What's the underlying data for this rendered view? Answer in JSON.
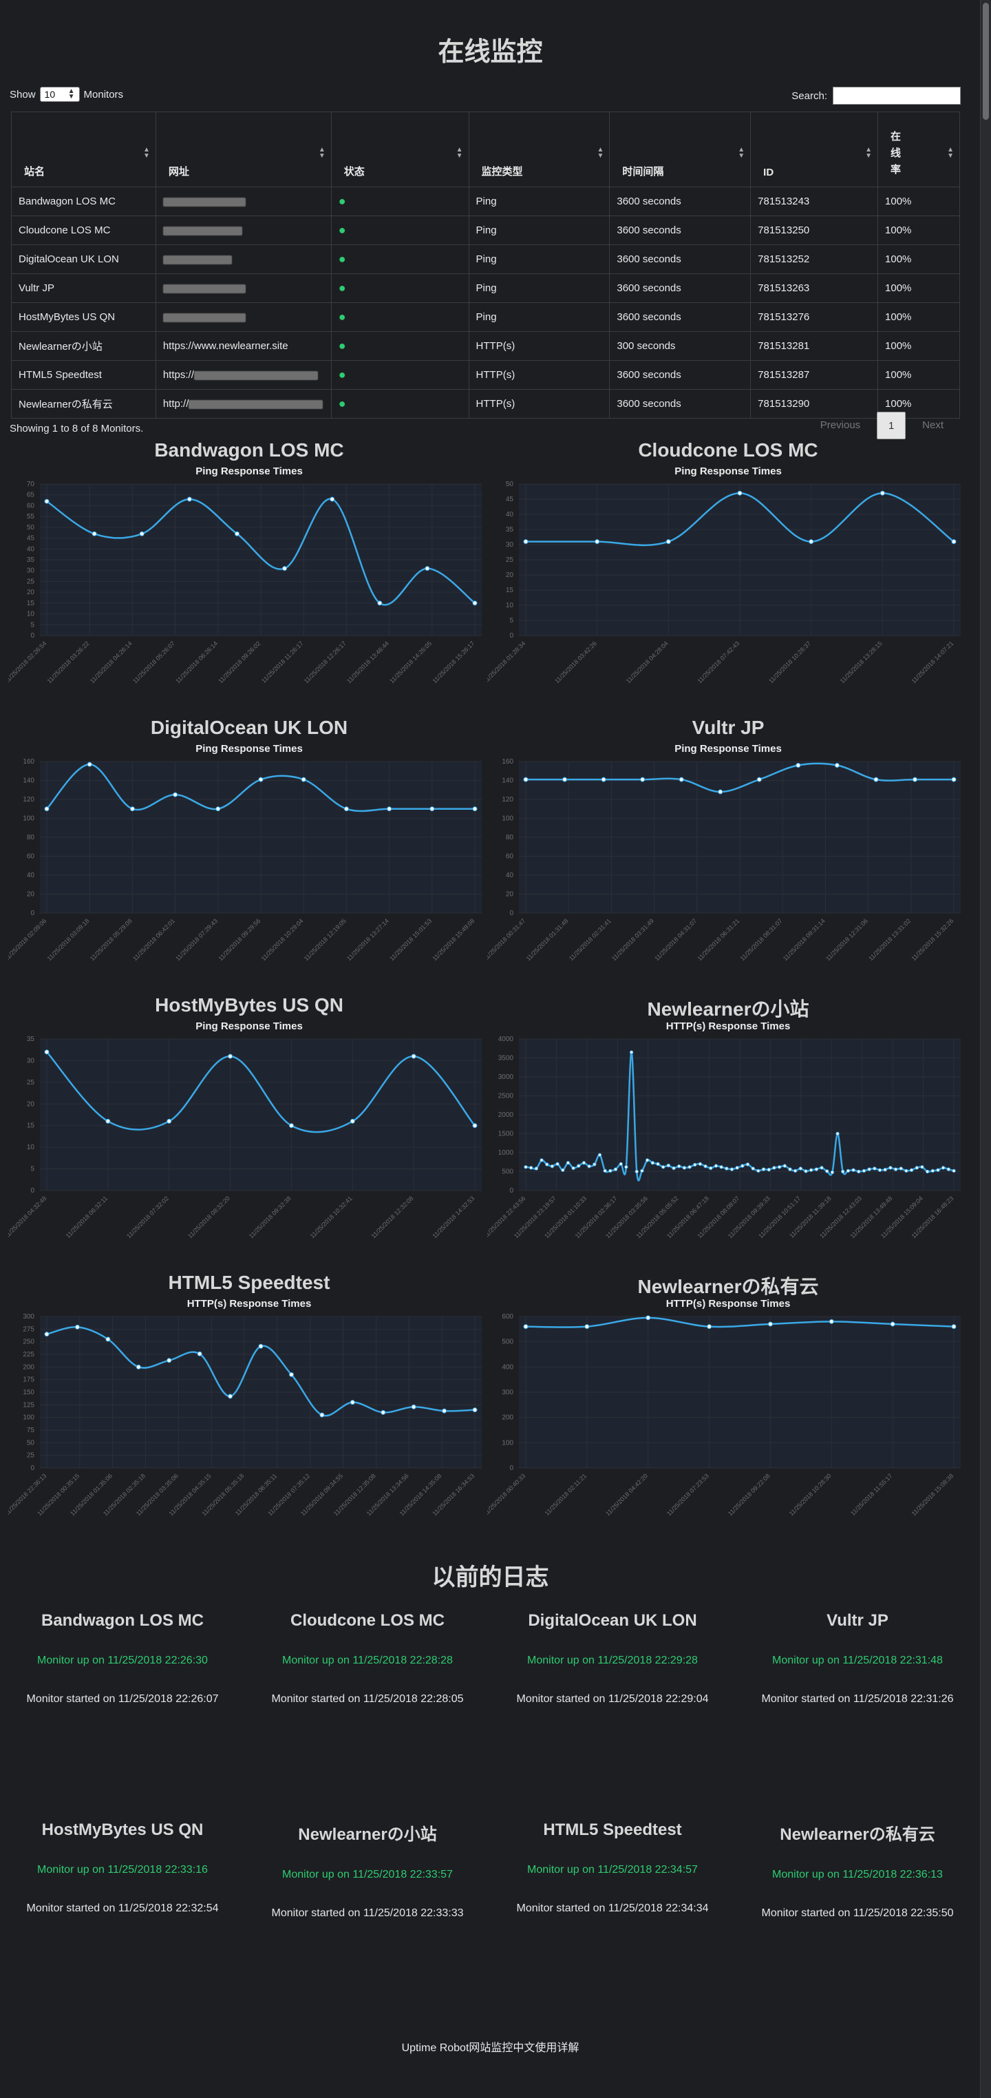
{
  "page": {
    "title": "在线监控"
  },
  "controls": {
    "show_label": "Show",
    "show_value": "10",
    "monitors_label": "Monitors",
    "search_label": "Search:"
  },
  "table": {
    "headers": [
      "站名",
      "网址",
      "状态",
      "监控类型",
      "时间间隔",
      "ID",
      "在线率"
    ],
    "rows": [
      {
        "name": "Bandwagon LOS MC",
        "url": "",
        "status": "●",
        "type": "Ping",
        "interval": "3600 seconds",
        "id": "781513243",
        "uptime": "100%"
      },
      {
        "name": "Cloudcone LOS MC",
        "url": "",
        "status": "●",
        "type": "Ping",
        "interval": "3600 seconds",
        "id": "781513250",
        "uptime": "100%"
      },
      {
        "name": "DigitalOcean UK LON",
        "url": "",
        "status": "●",
        "type": "Ping",
        "interval": "3600 seconds",
        "id": "781513252",
        "uptime": "100%"
      },
      {
        "name": "Vultr JP",
        "url": "",
        "status": "●",
        "type": "Ping",
        "interval": "3600 seconds",
        "id": "781513263",
        "uptime": "100%"
      },
      {
        "name": "HostMyBytes US QN",
        "url": "",
        "status": "●",
        "type": "Ping",
        "interval": "3600 seconds",
        "id": "781513276",
        "uptime": "100%"
      },
      {
        "name": "Newlearnerの小站",
        "url": "https://www.newlearner.site",
        "status": "●",
        "type": "HTTP(s)",
        "interval": "300 seconds",
        "id": "781513281",
        "uptime": "100%"
      },
      {
        "name": "HTML5 Speedtest",
        "url": "https://",
        "status": "●",
        "type": "HTTP(s)",
        "interval": "3600 seconds",
        "id": "781513287",
        "uptime": "100%"
      },
      {
        "name": "Newlearnerの私有云",
        "url": "http://",
        "status": "●",
        "type": "HTTP(s)",
        "interval": "3600 seconds",
        "id": "781513290",
        "uptime": "100%"
      }
    ],
    "info": "Showing 1 to 8 of 8 Monitors.",
    "pager": {
      "previous": "Previous",
      "current": "1",
      "next": "Next"
    }
  },
  "colors": {
    "line": "#3aa9e8",
    "status_up": "#2ecc71",
    "background": "#1d1e22"
  },
  "chart_data": [
    {
      "type": "line",
      "title": "Bandwagon LOS MC",
      "subtitle": "Ping Response Times",
      "ylim": [
        0,
        70
      ],
      "yticks": [
        0,
        5,
        10,
        15,
        20,
        25,
        30,
        35,
        40,
        45,
        50,
        55,
        60,
        65,
        70
      ],
      "x": [
        "11/25/2018 02:26:54",
        "11/25/2018 03:26:22",
        "11/25/2018 04:26:14",
        "11/25/2018 05:26:07",
        "11/25/2018 06:26:14",
        "11/25/2018 09:26:02",
        "11/25/2018 11:26:17",
        "11/25/2018 12:26:17",
        "11/25/2018 13:46:44",
        "11/25/2018 14:26:05",
        "11/25/2018 15:26:17"
      ],
      "values": [
        62,
        47,
        47,
        63,
        47,
        31,
        63,
        15,
        31,
        15
      ]
    },
    {
      "type": "line",
      "title": "Cloudcone LOS MC",
      "subtitle": "Ping Response Times",
      "ylim": [
        0,
        50
      ],
      "yticks": [
        0,
        5,
        10,
        15,
        20,
        25,
        30,
        35,
        40,
        45,
        50
      ],
      "x": [
        "11/25/2018 01:28:34",
        "11/25/2018 03:42:26",
        "11/25/2018 04:28:04",
        "11/25/2018 07:42:43",
        "11/25/2018 10:28:37",
        "11/25/2018 13:28:15",
        "11/25/2018 14:07:21"
      ],
      "values": [
        31,
        31,
        31,
        47,
        31,
        47,
        31
      ]
    },
    {
      "type": "line",
      "title": "DigitalOcean UK LON",
      "subtitle": "Ping Response Times",
      "ylim": [
        0,
        160
      ],
      "yticks": [
        0,
        20,
        40,
        60,
        80,
        100,
        120,
        140,
        160
      ],
      "x": [
        "11/25/2018 02:09:06",
        "11/25/2018 03:09:18",
        "11/25/2018 05:29:08",
        "11/25/2018 06:42:01",
        "11/25/2018 07:29:43",
        "11/25/2018 09:29:56",
        "11/25/2018 10:29:04",
        "11/25/2018 12:19:05",
        "11/25/2018 13:27:14",
        "11/25/2018 15:01:53",
        "11/25/2018 15:49:08"
      ],
      "values": [
        110,
        157,
        110,
        125,
        110,
        141,
        141,
        110,
        110,
        110,
        110
      ]
    },
    {
      "type": "line",
      "title": "Vultr JP",
      "subtitle": "Ping Response Times",
      "ylim": [
        0,
        160
      ],
      "yticks": [
        0,
        20,
        40,
        60,
        80,
        100,
        120,
        140,
        160
      ],
      "x": [
        "11/25/2018 00:31:47",
        "11/25/2018 01:31:48",
        "11/25/2018 02:31:41",
        "11/25/2018 03:31:49",
        "11/25/2018 04:31:07",
        "11/25/2018 06:31:21",
        "11/25/2018 08:31:07",
        "11/25/2018 09:31:14",
        "11/25/2018 12:31:06",
        "11/25/2018 13:31:02",
        "11/25/2018 15:32:26"
      ],
      "values": [
        141,
        141,
        141,
        141,
        141,
        128,
        141,
        156,
        156,
        141,
        141,
        141
      ]
    },
    {
      "type": "line",
      "title": "HostMyBytes US QN",
      "subtitle": "Ping Response Times",
      "ylim": [
        0,
        35
      ],
      "yticks": [
        0,
        5,
        10,
        15,
        20,
        25,
        30,
        35
      ],
      "x": [
        "11/25/2018 04:32:48",
        "11/25/2018 06:32:11",
        "11/25/2018 07:32:02",
        "11/25/2018 08:32:20",
        "11/25/2018 09:32:38",
        "11/25/2018 10:32:41",
        "11/25/2018 12:32:08",
        "11/25/2018 14:32:53"
      ],
      "values": [
        32,
        16,
        16,
        31,
        15,
        16,
        31,
        15
      ]
    },
    {
      "type": "line",
      "title": "Newlearnerの小站",
      "subtitle": "HTTP(s) Response Times",
      "ylim": [
        0,
        4000
      ],
      "yticks": [
        0,
        500,
        1000,
        1500,
        2000,
        2500,
        3000,
        3500,
        4000
      ],
      "x": [
        "11/25/2018 22:43:56",
        "11/25/2018 23:19:57",
        "11/25/2018 01:10:33",
        "11/25/2018 02:36:17",
        "11/25/2018 03:35:56",
        "11/25/2018 05:05:52",
        "11/25/2018 06:47:18",
        "11/25/2018 08:08:07",
        "11/25/2018 09:39:33",
        "11/25/2018 10:51:17",
        "11/25/2018 11:39:18",
        "11/25/2018 12:43:03",
        "11/25/2018 13:49:48",
        "11/25/2018 15:09:04",
        "11/25/2018 16:48:23"
      ],
      "values": [
        620,
        600,
        580,
        800,
        690,
        640,
        700,
        540,
        730,
        590,
        650,
        730,
        640,
        690,
        940,
        520,
        520,
        560,
        700,
        620,
        3650,
        500,
        520,
        800,
        730,
        700,
        620,
        660,
        590,
        640,
        600,
        620,
        680,
        700,
        640,
        590,
        650,
        620,
        580,
        560,
        600,
        650,
        690,
        580,
        520,
        560,
        550,
        600,
        620,
        650,
        560,
        520,
        580,
        510,
        540,
        560,
        600,
        510,
        480,
        1500,
        500,
        520,
        540,
        500,
        520,
        560,
        580,
        540,
        550,
        600,
        560,
        580,
        520,
        540,
        600,
        620,
        500,
        520,
        540,
        600,
        560,
        520
      ]
    },
    {
      "type": "line",
      "title": "HTML5 Speedtest",
      "subtitle": "HTTP(s) Response Times",
      "ylim": [
        0,
        300
      ],
      "yticks": [
        0,
        25,
        50,
        75,
        100,
        125,
        150,
        175,
        200,
        225,
        250,
        275,
        300
      ],
      "x": [
        "11/25/2018 22:36:13",
        "11/25/2018 00:35:15",
        "11/25/2018 01:35:06",
        "11/25/2018 02:35:18",
        "11/25/2018 03:35:06",
        "11/25/2018 04:35:15",
        "11/25/2018 05:35:18",
        "11/25/2018 06:35:11",
        "11/25/2018 07:35:12",
        "11/25/2018 09:34:55",
        "11/25/2018 12:35:08",
        "11/25/2018 13:34:56",
        "11/25/2018 14:35:08",
        "11/25/2018 16:34:53"
      ],
      "values": [
        265,
        279,
        255,
        200,
        213,
        226,
        142,
        241,
        185,
        105,
        130,
        110,
        121,
        113,
        115
      ]
    },
    {
      "type": "line",
      "title": "Newlearnerの私有云",
      "subtitle": "HTTP(s) Response Times",
      "ylim": [
        0,
        600
      ],
      "yticks": [
        0,
        100,
        200,
        300,
        400,
        500,
        600
      ],
      "x": [
        "11/25/2018 00:40:33",
        "11/25/2018 02:11:21",
        "11/25/2018 04:42:20",
        "11/25/2018 07:23:53",
        "11/25/2018 09:22:08",
        "11/25/2018 10:28:30",
        "11/25/2018 11:55:17",
        "11/25/2018 15:08:38"
      ],
      "values": [
        560,
        560,
        595,
        560,
        570,
        580,
        570,
        560
      ]
    }
  ],
  "logs": {
    "title": "以前的日志",
    "items": [
      {
        "name": "Bandwagon LOS MC",
        "up": "Monitor up on 11/25/2018 22:26:30",
        "started": "Monitor started on 11/25/2018 22:26:07"
      },
      {
        "name": "Cloudcone LOS MC",
        "up": "Monitor up on 11/25/2018 22:28:28",
        "started": "Monitor started on 11/25/2018 22:28:05"
      },
      {
        "name": "DigitalOcean UK LON",
        "up": "Monitor up on 11/25/2018 22:29:28",
        "started": "Monitor started on 11/25/2018 22:29:04"
      },
      {
        "name": "Vultr JP",
        "up": "Monitor up on 11/25/2018 22:31:48",
        "started": "Monitor started on 11/25/2018 22:31:26"
      },
      {
        "name": "HostMyBytes US QN",
        "up": "Monitor up on 11/25/2018 22:33:16",
        "started": "Monitor started on 11/25/2018 22:32:54"
      },
      {
        "name": "Newlearnerの小站",
        "up": "Monitor up on 11/25/2018 22:33:57",
        "started": "Monitor started on 11/25/2018 22:33:33"
      },
      {
        "name": "HTML5 Speedtest",
        "up": "Monitor up on 11/25/2018 22:34:57",
        "started": "Monitor started on 11/25/2018 22:34:34"
      },
      {
        "name": "Newlearnerの私有云",
        "up": "Monitor up on 11/25/2018 22:36:13",
        "started": "Monitor started on 11/25/2018 22:35:50"
      }
    ]
  },
  "footer": {
    "text": "Uptime Robot网站监控中文使用详解"
  }
}
